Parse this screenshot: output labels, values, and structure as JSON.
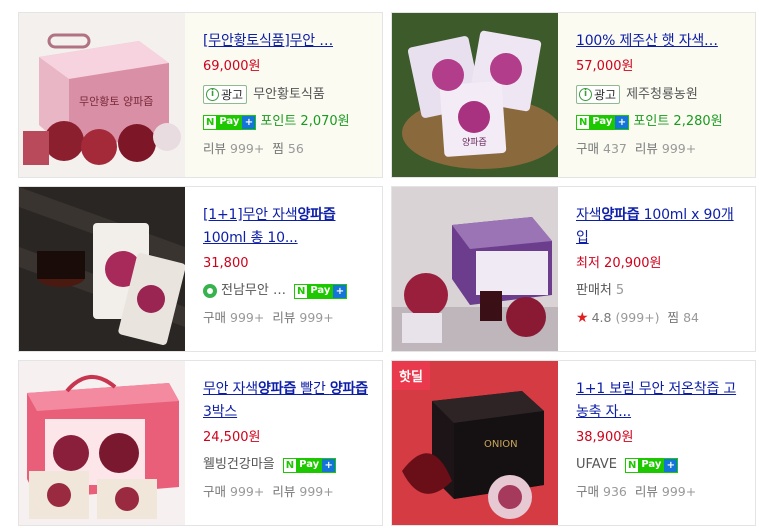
{
  "cards": [
    {
      "title": "[무안황토식품]무안 …",
      "price": "69,000원",
      "ad_label": "광고",
      "seller": "무안황토식품",
      "point": "포인트 2,070원",
      "stats": [
        {
          "label": "리뷰",
          "value": "999+"
        },
        {
          "label": "찜",
          "value": "56"
        }
      ]
    },
    {
      "title": "100% 제주산 햇 자색…",
      "price": "57,000원",
      "ad_label": "광고",
      "seller": "제주청룡농원",
      "point": "포인트 2,280원",
      "stats": [
        {
          "label": "구매",
          "value": "437"
        },
        {
          "label": "리뷰",
          "value": "999+"
        }
      ]
    },
    {
      "title_pre": "[1+1]무안 자색",
      "title_bold": "양파즙",
      "title_post": " 100ml 총 10...",
      "price": "31,800",
      "seller": "전남무안 …",
      "stats": [
        {
          "label": "구매",
          "value": "999+"
        },
        {
          "label": "리뷰",
          "value": "999+"
        }
      ]
    },
    {
      "title_pre": "자색",
      "title_bold": "양파즙",
      "title_post": " 100ml x 90개입",
      "price": "최저 20,900원",
      "sellers_label": "판매처",
      "sellers_count": "5",
      "rating": "4.8",
      "rating_count": "(999+)",
      "zzim_label": "찜",
      "zzim_value": "84"
    },
    {
      "title_pre": "무안 자색",
      "title_bold": "양파즙",
      "title_mid": " 빨간 ",
      "title_bold2": "양파즙",
      "title_post": " 3박스",
      "price": "24,500원",
      "seller": "웰빙건강마을",
      "stats": [
        {
          "label": "구매",
          "value": "999+"
        },
        {
          "label": "리뷰",
          "value": "999+"
        }
      ]
    },
    {
      "hot_label": "핫딜",
      "title": "1+1 보림 무안 저온착즙 고농축 자...",
      "price": "38,900원",
      "seller": "UFAVE",
      "stats": [
        {
          "label": "구매",
          "value": "936"
        },
        {
          "label": "리뷰",
          "value": "999+"
        }
      ]
    }
  ],
  "npay": {
    "n": "N",
    "pay": "Pay",
    "plus": "+"
  },
  "ad_icon": "i",
  "star_icon": "★",
  "thumb_text": {
    "box1": "무안황토 양파즙",
    "pack2": "양파즙",
    "box6": "ONION"
  },
  "colors": {
    "accent_link": "#0d1ea8",
    "price": "#d0011b",
    "npay": "#1ec800",
    "hot": "#e8394d"
  }
}
